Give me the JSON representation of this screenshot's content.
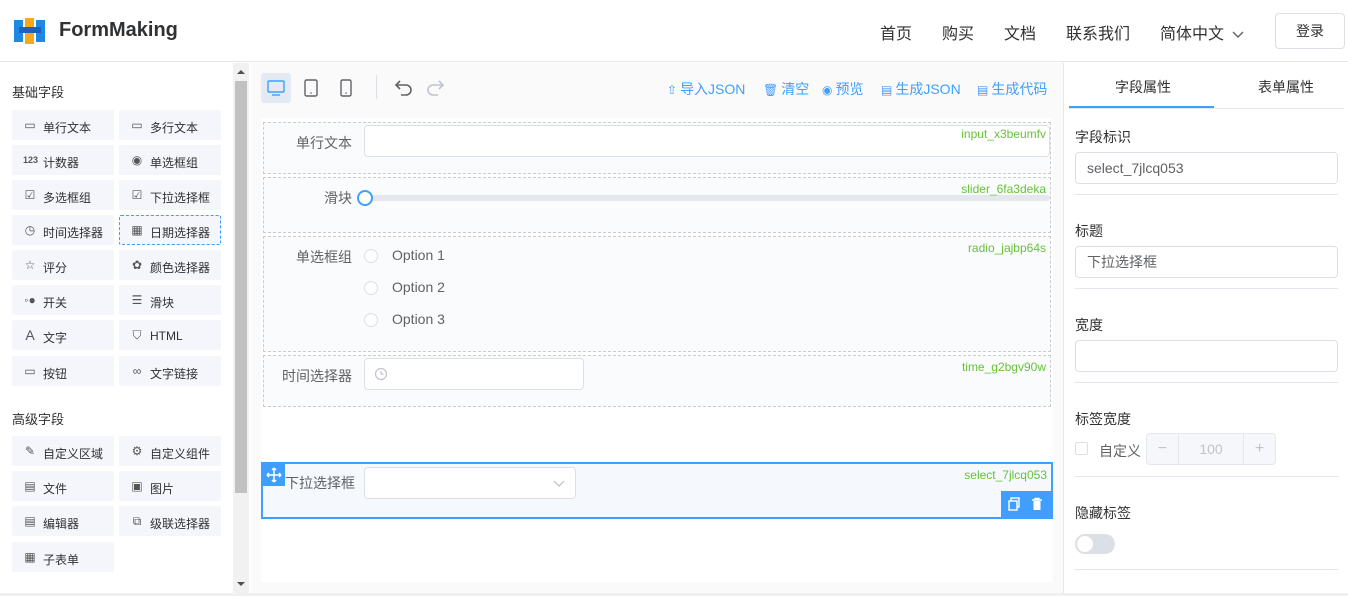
{
  "header": {
    "brand": "FormMaking",
    "nav": [
      "首页",
      "购买",
      "文档",
      "联系我们"
    ],
    "language": "简体中文",
    "login": "登录"
  },
  "left_panel": {
    "basic_title": "基础字段",
    "basic_fields": [
      {
        "label": "单行文本",
        "icon": "input-icon"
      },
      {
        "label": "多行文本",
        "icon": "textarea-icon"
      },
      {
        "label": "计数器",
        "icon": "number-icon"
      },
      {
        "label": "单选框组",
        "icon": "radio-icon"
      },
      {
        "label": "多选框组",
        "icon": "checkbox-icon"
      },
      {
        "label": "下拉选择框",
        "icon": "select-icon"
      },
      {
        "label": "时间选择器",
        "icon": "clock-icon"
      },
      {
        "label": "日期选择器",
        "icon": "calendar-icon"
      },
      {
        "label": "评分",
        "icon": "star-icon"
      },
      {
        "label": "颜色选择器",
        "icon": "palette-icon"
      },
      {
        "label": "开关",
        "icon": "switch-icon"
      },
      {
        "label": "滑块",
        "icon": "slider-icon"
      },
      {
        "label": "文字",
        "icon": "text-icon"
      },
      {
        "label": "HTML",
        "icon": "html-icon"
      },
      {
        "label": "按钮",
        "icon": "button-icon"
      },
      {
        "label": "文字链接",
        "icon": "link-icon"
      }
    ],
    "advanced_title": "高级字段",
    "advanced_fields": [
      {
        "label": "自定义区域",
        "icon": "edit-area-icon"
      },
      {
        "label": "自定义组件",
        "icon": "component-icon"
      },
      {
        "label": "文件",
        "icon": "file-icon"
      },
      {
        "label": "图片",
        "icon": "image-icon"
      },
      {
        "label": "编辑器",
        "icon": "editor-icon"
      },
      {
        "label": "级联选择器",
        "icon": "cascader-icon"
      },
      {
        "label": "子表单",
        "icon": "table-icon"
      }
    ]
  },
  "toolbar": {
    "import_json": "导入JSON",
    "clear": "清空",
    "preview": "预览",
    "generate_json": "生成JSON",
    "generate_code": "生成代码"
  },
  "canvas": {
    "fields": [
      {
        "label": "单行文本",
        "model": "input_x3beumfv"
      },
      {
        "label": "滑块",
        "model": "slider_6fa3deka"
      },
      {
        "label": "单选框组",
        "model": "radio_jajbp64s",
        "options": [
          "Option 1",
          "Option 2",
          "Option 3"
        ]
      },
      {
        "label": "时间选择器",
        "model": "time_g2bgv90w"
      },
      {
        "label": "下拉选择框",
        "model": "select_7jlcq053"
      }
    ]
  },
  "right_panel": {
    "tabs": [
      "字段属性",
      "表单属性"
    ],
    "field_id_label": "字段标识",
    "field_id_value": "select_7jlcq053",
    "title_label": "标题",
    "title_value": "下拉选择框",
    "width_label": "宽度",
    "width_value": "",
    "label_width_label": "标签宽度",
    "custom_label": "自定义",
    "label_width_value": "100",
    "hide_label": "隐藏标签"
  },
  "colors": {
    "accent": "#409eff",
    "model_tag": "#67c23a",
    "selected_border": "#409eff"
  }
}
